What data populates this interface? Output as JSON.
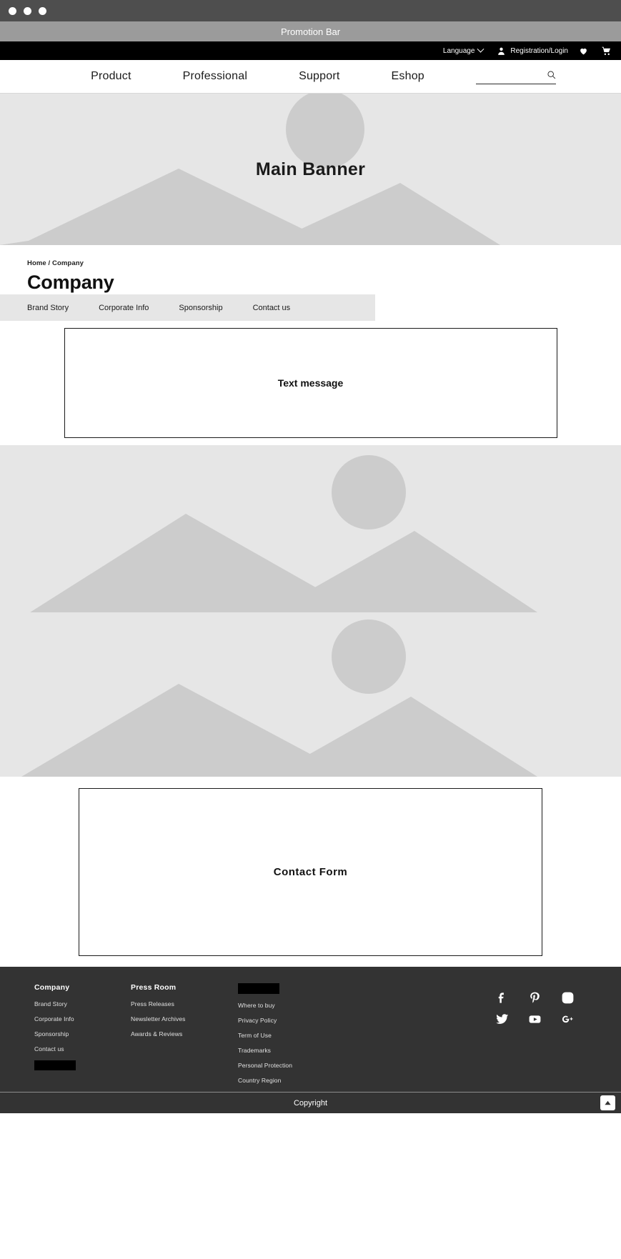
{
  "browser": {
    "traffic_lights": [
      "close",
      "minimize",
      "maximize"
    ]
  },
  "promotion_bar": {
    "text": "Promotion Bar"
  },
  "utility_bar": {
    "language_label": "Language",
    "language_caret_icon": "chevron-down-icon",
    "account_icon": "user-icon",
    "account_label": "Registration/Login",
    "wishlist_icon": "heart-icon",
    "cart_icon": "shopping-cart-icon"
  },
  "main_nav": {
    "items": [
      {
        "label": "Product"
      },
      {
        "label": "Professional"
      },
      {
        "label": "Support"
      },
      {
        "label": "Eshop"
      }
    ],
    "search": {
      "value": "",
      "placeholder": "",
      "icon": "search-icon"
    }
  },
  "hero": {
    "label": "Main Banner",
    "image_placeholder": "landscape-placeholder-icon"
  },
  "page": {
    "breadcrumb": "Home / Company",
    "title": "Company"
  },
  "tabs": [
    {
      "label": "Brand Story"
    },
    {
      "label": "Corporate Info"
    },
    {
      "label": "Sponsorship"
    },
    {
      "label": "Contact us"
    }
  ],
  "text_message_box": {
    "label": "Text message"
  },
  "media_blocks": [
    {
      "placeholder": "landscape-placeholder-icon"
    },
    {
      "placeholder": "landscape-placeholder-icon"
    }
  ],
  "contact_form_box": {
    "label": "Contact  Form"
  },
  "footer": {
    "columns": [
      {
        "heading": "Company",
        "heading_redacted": false,
        "links": [
          "Brand Story",
          "Corporate Info",
          "Sponsorship",
          "Contact us"
        ],
        "trailing_redacted_block": true
      },
      {
        "heading": "Press Room",
        "heading_redacted": false,
        "links": [
          "Press Releases",
          "Newsletter Archives",
          "Awards & Reviews"
        ],
        "trailing_redacted_block": false
      },
      {
        "heading": "",
        "heading_redacted": true,
        "links": [
          "Where to buy",
          "Privacy Policy",
          "Term of Use",
          "Trademarks",
          "Personal Protection",
          "Country Region"
        ],
        "trailing_redacted_block": false
      }
    ],
    "social": [
      {
        "name": "facebook-icon"
      },
      {
        "name": "pinterest-icon"
      },
      {
        "name": "instagram-icon"
      },
      {
        "name": "twitter-icon"
      },
      {
        "name": "youtube-icon"
      },
      {
        "name": "googleplus-icon"
      }
    ]
  },
  "copyright": {
    "text": "Copyright",
    "to_top_icon": "chevron-up-icon"
  },
  "colors": {
    "titlebar": "#4e4e4e",
    "promo": "#9b9b9b",
    "utility": "#000000",
    "placeholder_bg": "#e6e6e6",
    "placeholder_shape": "#cccccc",
    "footer": "#333333"
  }
}
